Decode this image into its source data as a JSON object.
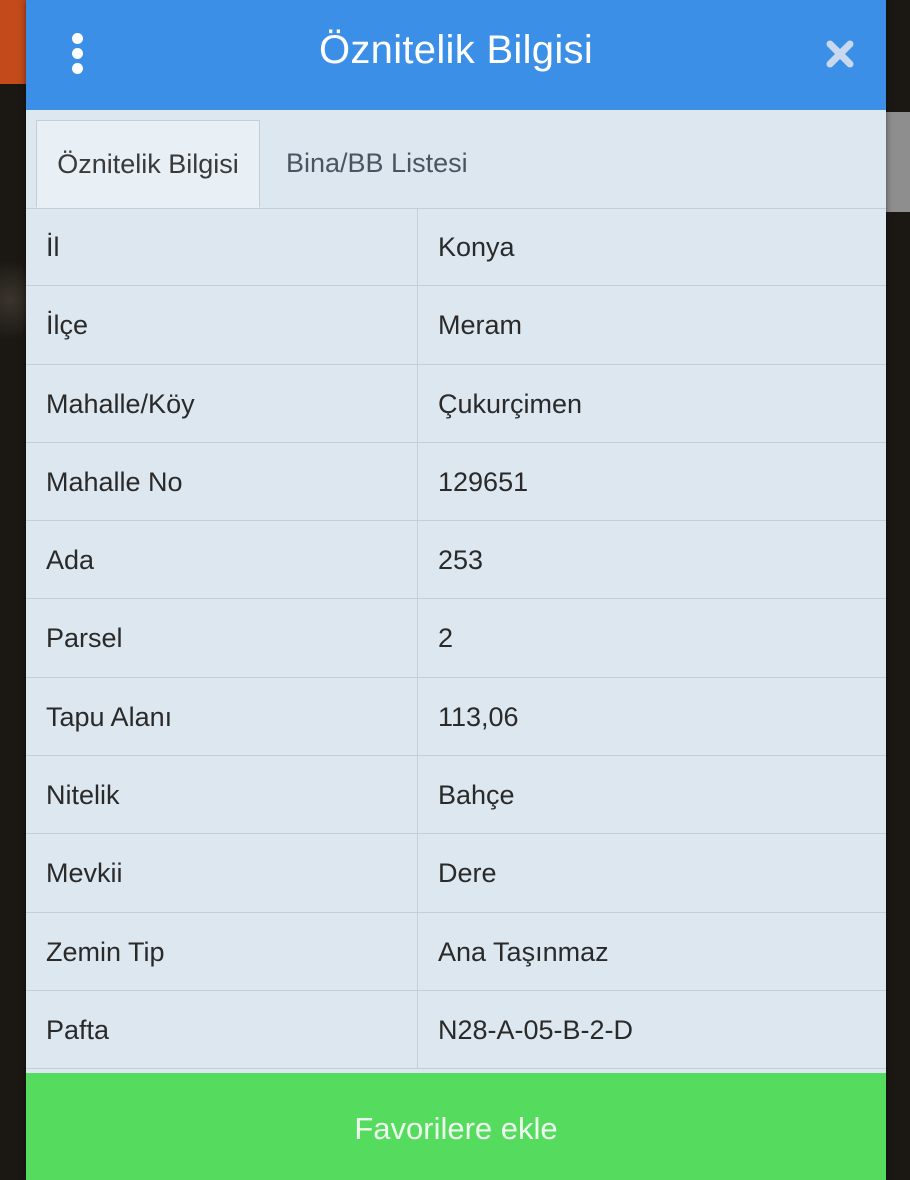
{
  "dialog": {
    "title": "Öznitelik Bilgisi"
  },
  "tabs": [
    {
      "label": "Öznitelik Bilgisi",
      "active": true
    },
    {
      "label": "Bina/BB Listesi",
      "active": false
    }
  ],
  "rows": [
    {
      "key": "İl",
      "value": "Konya"
    },
    {
      "key": "İlçe",
      "value": "Meram"
    },
    {
      "key": "Mahalle/Köy",
      "value": "Çukurçimen"
    },
    {
      "key": "Mahalle No",
      "value": "129651"
    },
    {
      "key": "Ada",
      "value": "253"
    },
    {
      "key": "Parsel",
      "value": "2"
    },
    {
      "key": "Tapu Alanı",
      "value": "113,06"
    },
    {
      "key": "Nitelik",
      "value": "Bahçe"
    },
    {
      "key": "Mevkii",
      "value": "Dere"
    },
    {
      "key": "Zemin Tip",
      "value": "Ana Taşınmaz"
    },
    {
      "key": "Pafta",
      "value": "N28-A-05-B-2-D"
    }
  ],
  "favorite_button": "Favorilere ekle",
  "icons": {
    "menu": "more-vertical-icon",
    "close": "close-icon"
  },
  "colors": {
    "header": "#3b8fe6",
    "panel": "#dde7ef",
    "favorite_button": "#55dc5e"
  }
}
